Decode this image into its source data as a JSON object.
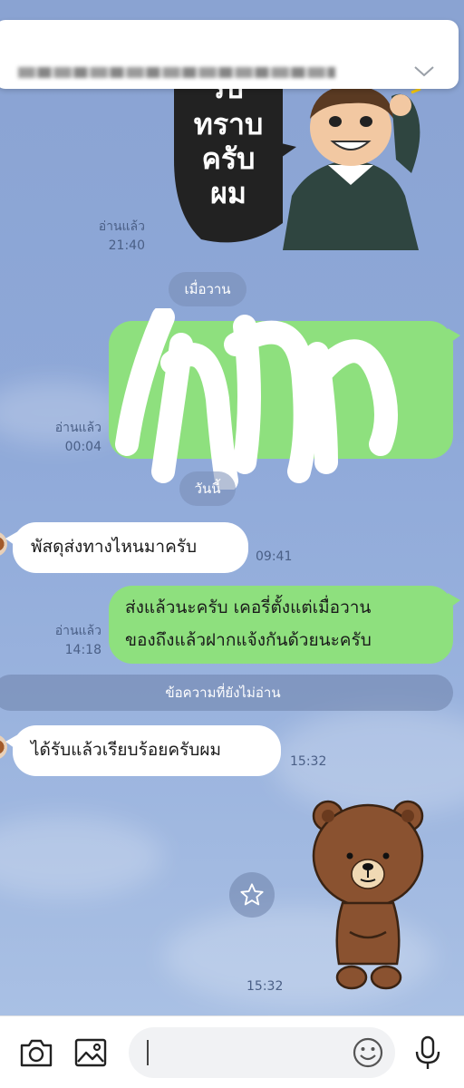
{
  "banner": {
    "text": ""
  },
  "messages": {
    "sticker1_read": "อ่านแล้ว",
    "sticker1_time": "21:40",
    "date_yesterday": "เมื่อวาน",
    "redacted_read": "อ่านแล้ว",
    "redacted_time": "00:04",
    "date_today": "วันนี้",
    "in1_text": "พัสดุส่งทางไหนมาครับ",
    "in1_time": "09:41",
    "out1_line1": "ส่งแล้วนะครับ เคอรี่ตั้งแต่เมื่อวาน",
    "out1_line2": "ของถึงแล้วฝากแจ้งกันด้วยนะครับ",
    "out1_read": "อ่านแล้ว",
    "out1_time": "14:18",
    "unread_divider": "ข้อความที่ยังไม่อ่าน",
    "in2_text": "ได้รับแล้วเรียบร้อยครับผม",
    "in2_time": "15:32",
    "sticker2_time": "15:32"
  },
  "sticker1": {
    "text_line1": "รับ",
    "text_line2": "ทราบ",
    "text_line3": "ครับ",
    "text_line4": "ผม"
  },
  "input": {
    "placeholder": "",
    "value": ""
  },
  "colors": {
    "chat_bg": "#8ea8d8",
    "out_bubble": "#8ee07e",
    "in_bubble": "#ffffff"
  }
}
